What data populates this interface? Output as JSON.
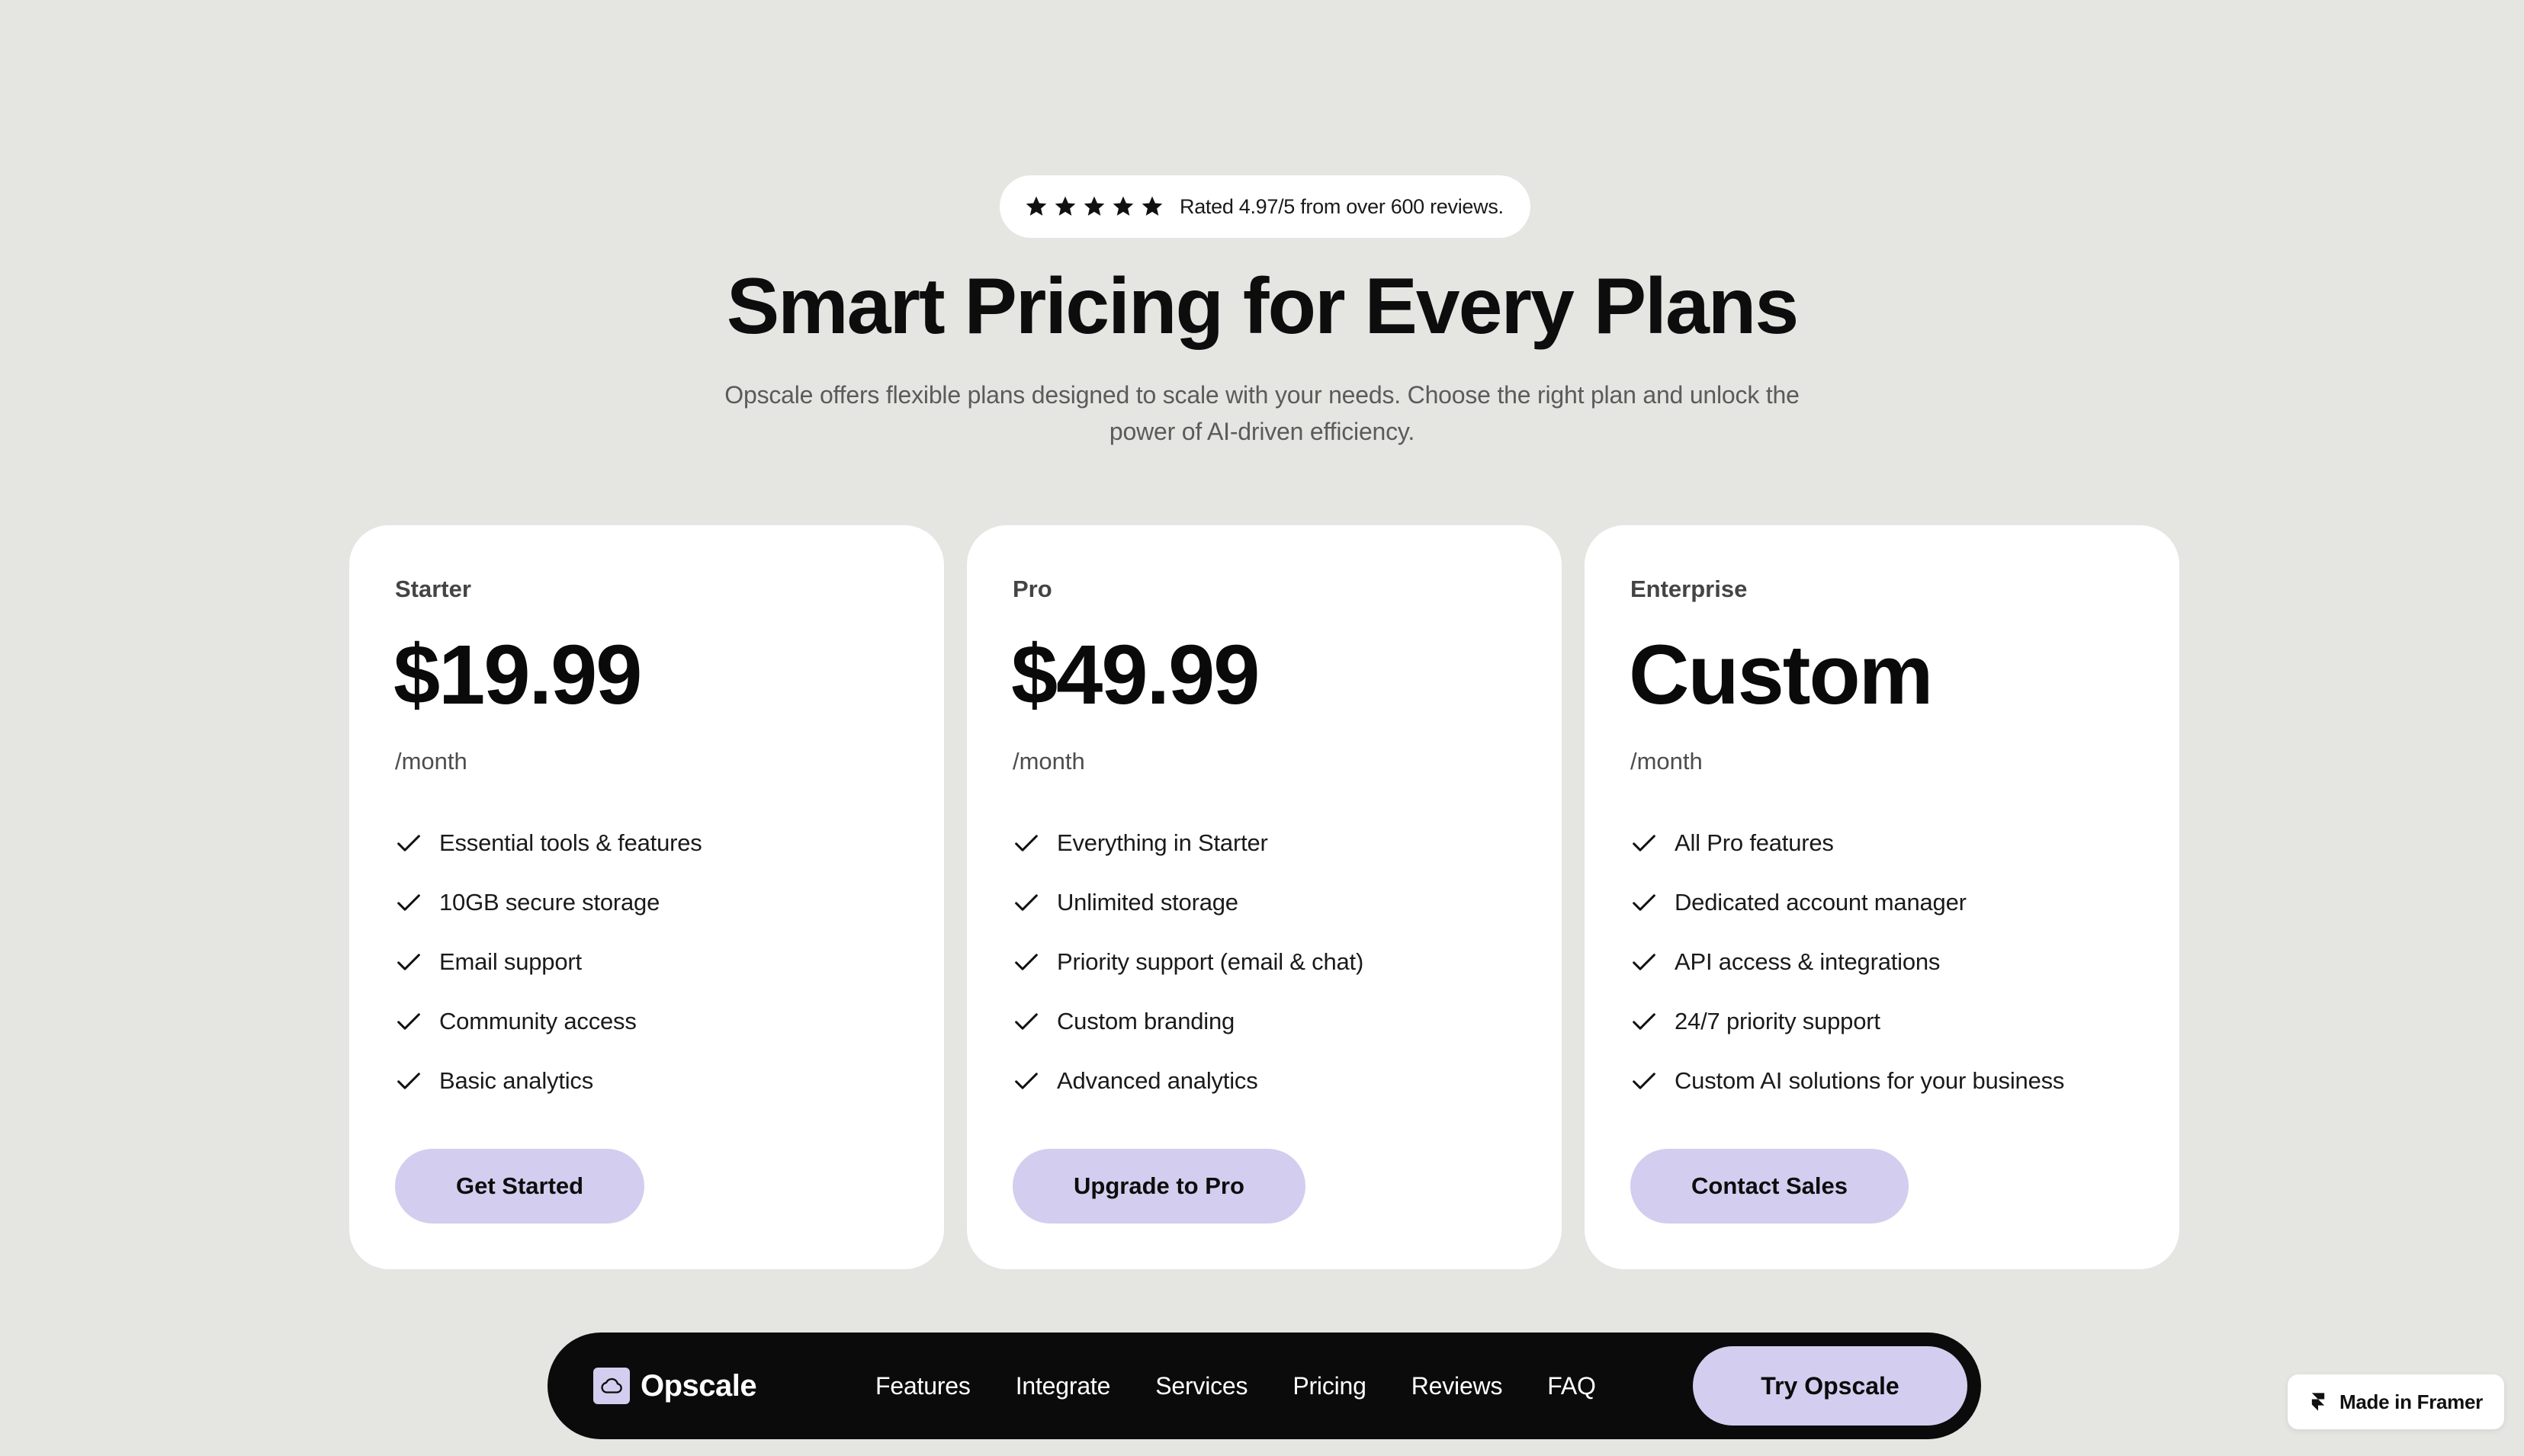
{
  "rating": {
    "stars": 5,
    "icon": "star-icon",
    "text": "Rated 4.97/5 from over 600 reviews."
  },
  "hero": {
    "title": "Smart Pricing for Every Plans",
    "subtitle_line1": "Opscale offers flexible plans designed to scale with your needs. Choose the right plan and unlock the",
    "subtitle_line2": "power of AI-driven efficiency."
  },
  "plans": [
    {
      "name": "Starter",
      "price": "$19.99",
      "period": "/month",
      "features": [
        "Essential tools & features",
        "10GB secure storage",
        "Email support",
        "Community access",
        "Basic analytics"
      ],
      "cta": "Get Started"
    },
    {
      "name": "Pro",
      "price": "$49.99",
      "period": "/month",
      "features": [
        "Everything in Starter",
        "Unlimited storage",
        "Priority support (email & chat)",
        "Custom branding",
        "Advanced analytics"
      ],
      "cta": "Upgrade to Pro"
    },
    {
      "name": "Enterprise",
      "price": "Custom",
      "period": "/month",
      "features": [
        "All Pro features",
        "Dedicated account manager",
        "API access & integrations",
        "24/7 priority support",
        "Custom AI solutions for your business"
      ],
      "cta": "Contact Sales"
    }
  ],
  "nav": {
    "brand": "Opscale",
    "brand_icon": "cloud-icon",
    "links": [
      "Features",
      "Integrate",
      "Services",
      "Pricing",
      "Reviews",
      "FAQ"
    ],
    "cta": "Try Opscale"
  },
  "badge": {
    "label": "Made in Framer",
    "icon": "framer-icon"
  },
  "colors": {
    "background": "#e5e5e1",
    "card": "#ffffff",
    "accent": "#d3cdef",
    "nav": "#0b0b0b",
    "text": "#0d0d0d"
  }
}
